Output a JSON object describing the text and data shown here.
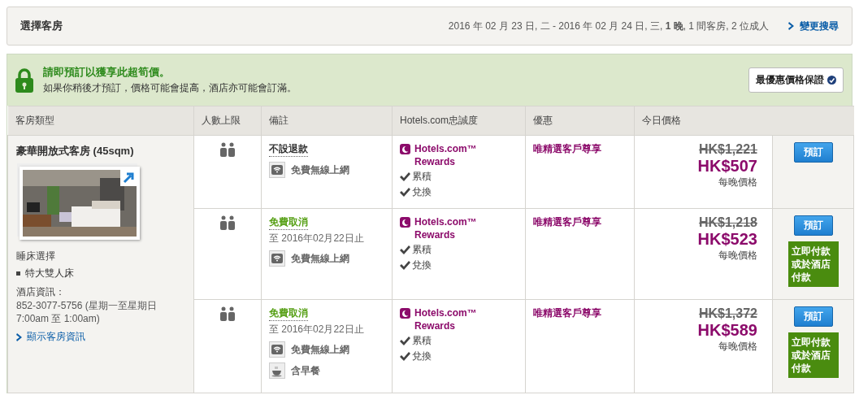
{
  "header": {
    "title": "選擇客房",
    "summary": "2016 年 02 月 23 日, 二 - 2016 年 02 月 24 日, 三, **1 晚**, 1 間客房, 2 位成人",
    "change_link": "變更搜尋"
  },
  "banner": {
    "headline": "請即預訂以獲享此超筍價。",
    "text": "如果你稍後才預訂，價格可能會提高，酒店亦可能會訂滿。",
    "guarantee_button": "最優惠價格保證"
  },
  "table": {
    "columns": [
      "客房類型",
      "人數上限",
      "備註",
      "Hotels.com忠誠度",
      "優惠",
      "今日價格"
    ],
    "room": {
      "name": "豪華開放式客房 (45sqm)",
      "bed_label": "睡床選擇",
      "beds": [
        "特大雙人床"
      ],
      "info_label": "酒店資訊：",
      "info_text": "852-3077-5756 (星期一至星期日 7:00am 至 1:00am)",
      "details_link": "顯示客房資訊"
    },
    "rows": [
      {
        "policy": {
          "kind": "no_refund",
          "text": "不設退款"
        },
        "amenities": [
          {
            "kind": "wifi",
            "text": "免費無線上網"
          }
        ],
        "loyalty": {
          "name": "Hotels.com™ Rewards",
          "benefits": [
            "累積",
            "兌換"
          ]
        },
        "offer": "唯精選客戶尊享",
        "old_price": "HK$1,221",
        "price": "HK$507",
        "price_note": "每晚價格",
        "book_button": "預訂"
      },
      {
        "policy": {
          "kind": "free_cancel",
          "text": "免費取消",
          "deadline": "至 2016年02月22日止"
        },
        "amenities": [
          {
            "kind": "wifi",
            "text": "免費無線上網"
          }
        ],
        "loyalty": {
          "name": "Hotels.com™ Rewards",
          "benefits": [
            "累積",
            "兌換"
          ]
        },
        "offer": "唯精選客戶尊享",
        "old_price": "HK$1,218",
        "price": "HK$523",
        "price_note": "每晚價格",
        "book_button": "預訂",
        "pay_note": "立即付款或於酒店付款"
      },
      {
        "policy": {
          "kind": "free_cancel",
          "text": "免費取消",
          "deadline": "至 2016年02月22日止"
        },
        "amenities": [
          {
            "kind": "wifi",
            "text": "免費無線上網"
          },
          {
            "kind": "breakfast",
            "text": "含早餐"
          }
        ],
        "loyalty": {
          "name": "Hotels.com™ Rewards",
          "benefits": [
            "累積",
            "兌換"
          ]
        },
        "offer": "唯精選客戶尊享",
        "old_price": "HK$1,372",
        "price": "HK$589",
        "price_note": "每晚價格",
        "book_button": "預訂",
        "pay_note": "立即付款或於酒店付款"
      }
    ]
  }
}
